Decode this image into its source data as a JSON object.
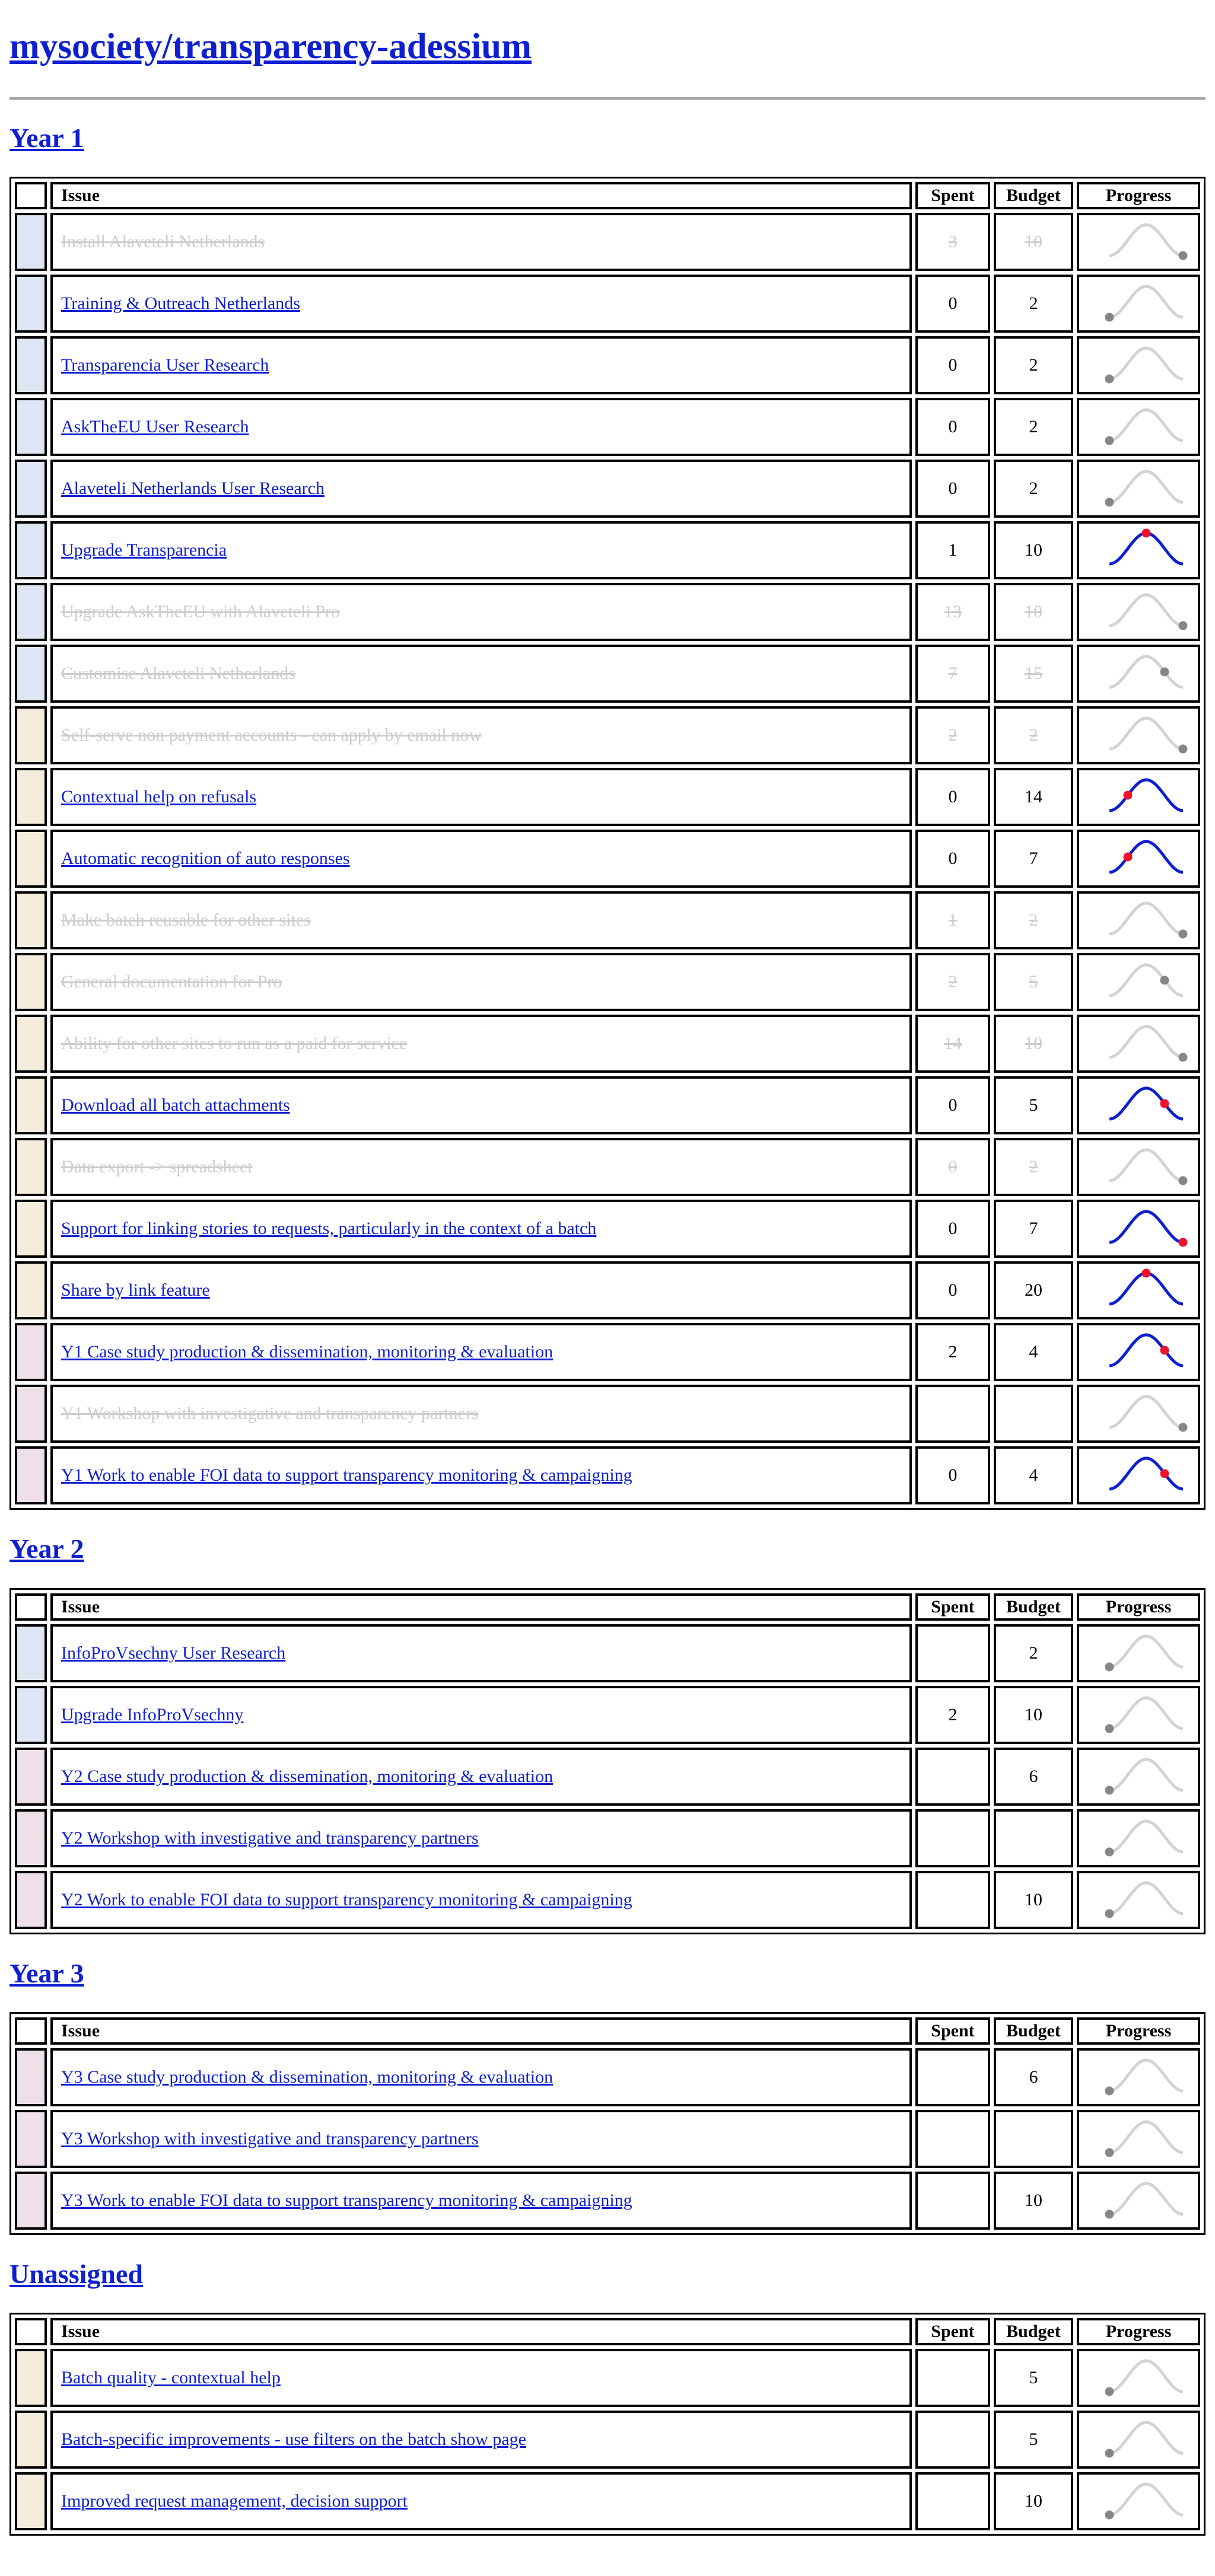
{
  "page": {
    "title": "mysociety/transparency-adessium"
  },
  "columns": {
    "issue": "Issue",
    "spent": "Spent",
    "budget": "Budget",
    "progress": "Progress"
  },
  "colors": {
    "link": "#0e1fd1",
    "closed_text": "#cdcdcd",
    "active_curve": "#0e1fd1",
    "active_dot": "#f0112b",
    "inactive_curve": "#d3d3d3",
    "inactive_dot": "#868686",
    "stripe_blue": "#dde6f2",
    "stripe_cream": "#f5ecdc",
    "stripe_pink": "#eedfe8"
  },
  "sections": [
    {
      "heading": "Year 1",
      "rows": [
        {
          "title": "Install Alaveteli Netherlands",
          "spent": "3",
          "budget": "10",
          "closed": true,
          "active": false,
          "progress": 1.0,
          "stripe": "blue"
        },
        {
          "title": "Training & Outreach Netherlands",
          "spent": "0",
          "budget": "2",
          "closed": false,
          "active": false,
          "progress": 0.0,
          "stripe": "blue"
        },
        {
          "title": "Transparencia User Research",
          "spent": "0",
          "budget": "2",
          "closed": false,
          "active": false,
          "progress": 0.0,
          "stripe": "blue"
        },
        {
          "title": "AskTheEU User Research",
          "spent": "0",
          "budget": "2",
          "closed": false,
          "active": false,
          "progress": 0.0,
          "stripe": "blue"
        },
        {
          "title": "Alaveteli Netherlands User Research",
          "spent": "0",
          "budget": "2",
          "closed": false,
          "active": false,
          "progress": 0.0,
          "stripe": "blue"
        },
        {
          "title": "Upgrade Transparencia",
          "spent": "1",
          "budget": "10",
          "closed": false,
          "active": true,
          "progress": 0.5,
          "stripe": "blue"
        },
        {
          "title": "Upgrade AskTheEU with Alaveteli Pro",
          "spent": "13",
          "budget": "10",
          "closed": true,
          "active": false,
          "progress": 1.0,
          "stripe": "blue"
        },
        {
          "title": "Customise Alaveteli Netherlands",
          "spent": "7",
          "budget": "15",
          "closed": true,
          "active": false,
          "progress": 0.75,
          "stripe": "blue"
        },
        {
          "title": "Self-serve non payment accounts - can apply by email now",
          "spent": "2",
          "budget": "2",
          "closed": true,
          "active": false,
          "progress": 1.0,
          "stripe": "cream"
        },
        {
          "title": "Contextual help on refusals",
          "spent": "0",
          "budget": "14",
          "closed": false,
          "active": true,
          "progress": 0.25,
          "stripe": "cream"
        },
        {
          "title": "Automatic recognition of auto responses",
          "spent": "0",
          "budget": "7",
          "closed": false,
          "active": true,
          "progress": 0.25,
          "stripe": "cream"
        },
        {
          "title": "Make batch reusable for other sites",
          "spent": "1",
          "budget": "2",
          "closed": true,
          "active": false,
          "progress": 1.0,
          "stripe": "cream"
        },
        {
          "title": "General documentation for Pro",
          "spent": "2",
          "budget": "5",
          "closed": true,
          "active": false,
          "progress": 0.75,
          "stripe": "cream"
        },
        {
          "title": "Ability for other sites to run as a paid for service",
          "spent": "14",
          "budget": "10",
          "closed": true,
          "active": false,
          "progress": 1.0,
          "stripe": "cream"
        },
        {
          "title": "Download all batch attachments",
          "spent": "0",
          "budget": "5",
          "closed": false,
          "active": true,
          "progress": 0.75,
          "stripe": "cream"
        },
        {
          "title": "Data export -> spreadsheet",
          "spent": "0",
          "budget": "2",
          "closed": true,
          "active": false,
          "progress": 1.0,
          "stripe": "cream"
        },
        {
          "title": "Support for linking stories to requests, particularly in the context of a batch",
          "spent": "0",
          "budget": "7",
          "closed": false,
          "active": true,
          "progress": 1.0,
          "stripe": "cream"
        },
        {
          "title": "Share by link feature",
          "spent": "0",
          "budget": "20",
          "closed": false,
          "active": true,
          "progress": 0.5,
          "stripe": "cream"
        },
        {
          "title": "Y1 Case study production & dissemination, monitoring & evaluation",
          "spent": "2",
          "budget": "4",
          "closed": false,
          "active": true,
          "progress": 0.75,
          "stripe": "pink"
        },
        {
          "title": "Y1 Workshop with investigative and transparency partners",
          "spent": "",
          "budget": "",
          "closed": true,
          "active": false,
          "progress": 1.0,
          "stripe": "pink"
        },
        {
          "title": "Y1 Work to enable FOI data to support transparency monitoring & campaigning",
          "spent": "0",
          "budget": "4",
          "closed": false,
          "active": true,
          "progress": 0.75,
          "stripe": "pink"
        }
      ]
    },
    {
      "heading": "Year 2",
      "rows": [
        {
          "title": "InfoProVsechny User Research",
          "spent": "",
          "budget": "2",
          "closed": false,
          "active": false,
          "progress": 0.0,
          "stripe": "blue"
        },
        {
          "title": "Upgrade InfoProVsechny",
          "spent": "2",
          "budget": "10",
          "closed": false,
          "active": false,
          "progress": 0.0,
          "stripe": "blue"
        },
        {
          "title": "Y2 Case study production & dissemination, monitoring & evaluation",
          "spent": "",
          "budget": "6",
          "closed": false,
          "active": false,
          "progress": 0.0,
          "stripe": "pink"
        },
        {
          "title": "Y2 Workshop with investigative and transparency partners",
          "spent": "",
          "budget": "",
          "closed": false,
          "active": false,
          "progress": 0.0,
          "stripe": "pink"
        },
        {
          "title": "Y2 Work to enable FOI data to support transparency monitoring & campaigning",
          "spent": "",
          "budget": "10",
          "closed": false,
          "active": false,
          "progress": 0.0,
          "stripe": "pink"
        }
      ]
    },
    {
      "heading": "Year 3",
      "rows": [
        {
          "title": "Y3 Case study production & dissemination, monitoring & evaluation",
          "spent": "",
          "budget": "6",
          "closed": false,
          "active": false,
          "progress": 0.0,
          "stripe": "pink"
        },
        {
          "title": "Y3 Workshop with investigative and transparency partners",
          "spent": "",
          "budget": "",
          "closed": false,
          "active": false,
          "progress": 0.0,
          "stripe": "pink"
        },
        {
          "title": "Y3 Work to enable FOI data to support transparency monitoring & campaigning",
          "spent": "",
          "budget": "10",
          "closed": false,
          "active": false,
          "progress": 0.0,
          "stripe": "pink"
        }
      ]
    },
    {
      "heading": "Unassigned",
      "rows": [
        {
          "title": "Batch quality - contextual help",
          "spent": "",
          "budget": "5",
          "closed": false,
          "active": false,
          "progress": 0.0,
          "stripe": "cream"
        },
        {
          "title": "Batch-specific improvements - use filters on the batch show page",
          "spent": "",
          "budget": "5",
          "closed": false,
          "active": false,
          "progress": 0.0,
          "stripe": "cream"
        },
        {
          "title": "Improved request management, decision support",
          "spent": "",
          "budget": "10",
          "closed": false,
          "active": false,
          "progress": 0.0,
          "stripe": "cream"
        }
      ]
    }
  ]
}
